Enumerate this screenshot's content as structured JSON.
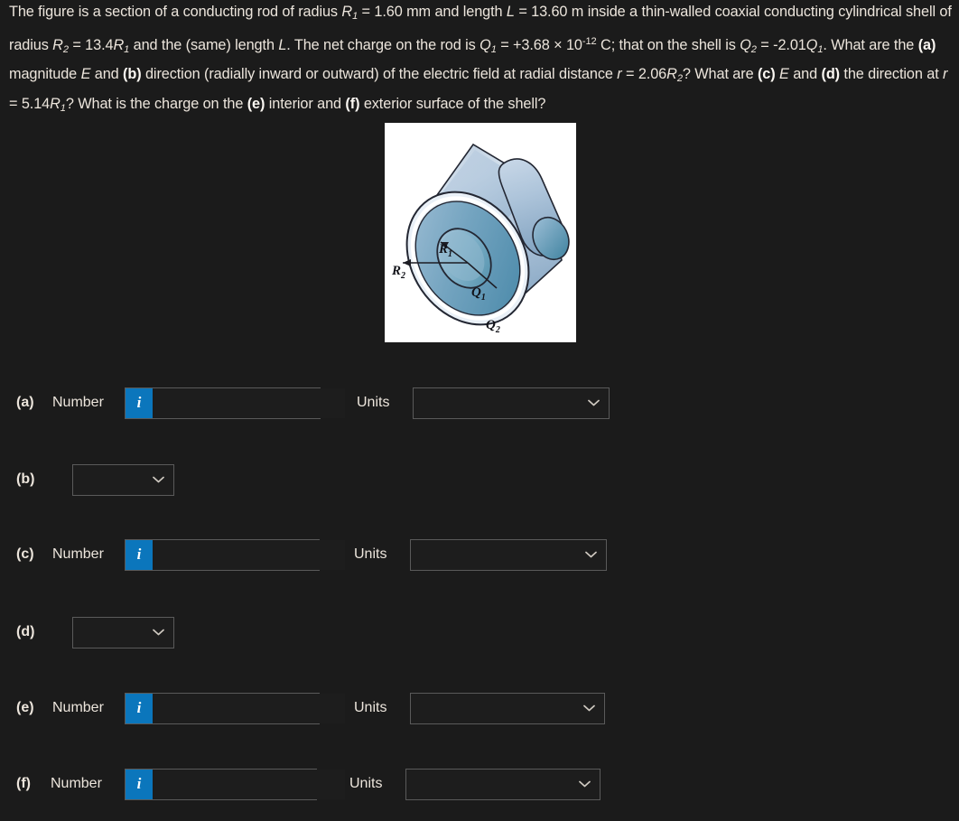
{
  "problem": {
    "line1_a": "The figure is a section of a conducting rod of radius ",
    "sym_R1a": "R",
    "sub_1a": "1",
    "line1_b": " = 1.60 mm and length ",
    "sym_L1": "L",
    "line1_c": " = 13.60 m inside a thin-walled coaxial conducting",
    "line2_a": "cylindrical shell of radius ",
    "sym_R2a": "R",
    "sub_2a": "2",
    "line2_b": " = 13.4",
    "sym_R1b": "R",
    "sub_1b": "1",
    "line2_c": " and the (same) length ",
    "sym_L2": "L",
    "line2_d": ". The net charge on the rod is ",
    "sym_Q1a": "Q",
    "sub_q1a": "1",
    "line2_e": " = +3.68 × 10",
    "exp_12": "-12",
    "line2_f": " C; that on the shell is ",
    "sym_Q2a": "Q",
    "sub_q2a": "2",
    "line2_g": " =",
    "line3_a": "-2.01",
    "sym_Q1b": "Q",
    "sub_q1b": "1",
    "line3_b": ". What are the ",
    "bold_a": "(a)",
    "line3_c": " magnitude ",
    "sym_E1": "E",
    "line3_d": " and ",
    "bold_b": "(b)",
    "line3_e": " direction (radially inward or outward) of the electric field at radial distance ",
    "sym_r1": "r",
    "line3_f": " = 2.06",
    "sym_R2b": "R",
    "sub_2b": "2",
    "line3_g": "?",
    "line4_a": "What are ",
    "bold_c": "(c)",
    "line4_b": " ",
    "sym_E2": "E",
    "line4_c": " and ",
    "bold_d": "(d)",
    "line4_d": " the direction at ",
    "sym_r2": "r",
    "line4_e": " = 5.14",
    "sym_R1c": "R",
    "sub_1c": "1",
    "line4_f": "? What is the charge on the ",
    "bold_e": "(e)",
    "line4_g": " interior and ",
    "bold_f": "(f)",
    "line4_h": " exterior surface of the shell?"
  },
  "figure": {
    "alt": "coaxial-conducting-rod-and-shell-diagram",
    "labels": {
      "R1": "R",
      "R1_sub": "1",
      "R2": "R",
      "R2_sub": "2",
      "Q1": "Q",
      "Q1_sub": "1",
      "Q2": "Q",
      "Q2_sub": "2"
    },
    "colors": {
      "shell_light": "#cdd9e8",
      "shell_mid": "#a9c0d8",
      "shell_dark": "#6f9cb8",
      "inner_dark": "#4e8ba6",
      "outline": "#20202a",
      "background": "#ffffff"
    }
  },
  "accent_color": "#0b76bc",
  "answers": [
    {
      "part": "(a)",
      "type": "number",
      "number_label": "Number",
      "info_glyph": "i",
      "number_value": "",
      "number_placeholder": "",
      "units_label": "Units",
      "units_value": "",
      "units_options": []
    },
    {
      "part": "(b)",
      "type": "select",
      "select_value": "",
      "select_options": []
    },
    {
      "part": "(c)",
      "type": "number",
      "number_label": "Number",
      "info_glyph": "i",
      "number_value": "",
      "number_placeholder": "",
      "units_label": "Units",
      "units_value": "",
      "units_options": []
    },
    {
      "part": "(d)",
      "type": "select",
      "select_value": "",
      "select_options": []
    },
    {
      "part": "(e)",
      "type": "number",
      "number_label": "Number",
      "info_glyph": "i",
      "number_value": "",
      "number_placeholder": "",
      "units_label": "Units",
      "units_value": "",
      "units_options": []
    },
    {
      "part": "(f)",
      "type": "number",
      "number_label": "Number",
      "info_glyph": "i",
      "number_value": "",
      "number_placeholder": "",
      "units_label": "Units",
      "units_value": "",
      "units_options": []
    }
  ]
}
